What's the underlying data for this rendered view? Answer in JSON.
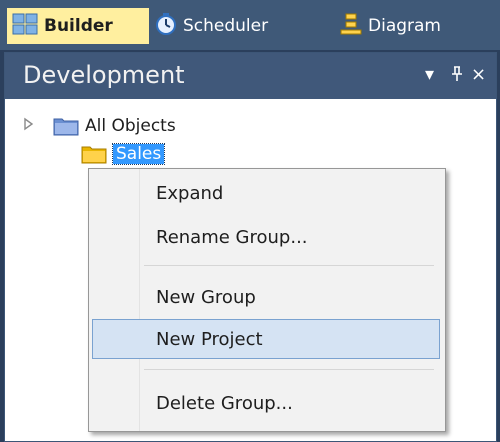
{
  "tabs": [
    {
      "label": "Builder",
      "icon": "builder-grid-icon",
      "active": true
    },
    {
      "label": "Scheduler",
      "icon": "clock-icon",
      "active": false
    },
    {
      "label": "Diagram",
      "icon": "diagram-icon",
      "active": false
    }
  ],
  "pane": {
    "title": "Development",
    "dropdown_icon": "▾",
    "pin_icon": "ᵖ",
    "close_icon": "×"
  },
  "tree": {
    "items": [
      {
        "label": "All Objects",
        "icon": "folder-blue-icon",
        "expandable": true
      },
      {
        "label": "Sales",
        "icon": "folder-yellow-icon",
        "selected": true
      }
    ]
  },
  "context_menu": {
    "items": [
      {
        "label": "Expand"
      },
      {
        "label": "Rename Group..."
      },
      {
        "label": "New Group"
      },
      {
        "label": "New Project",
        "highlighted": true
      },
      {
        "label": "Delete Group..."
      }
    ]
  },
  "colors": {
    "tab_active_bg": "#ffef9f",
    "chrome_bg": "#3f5978",
    "menu_highlight": "#d5e3f3",
    "selection": "#3399ff"
  }
}
